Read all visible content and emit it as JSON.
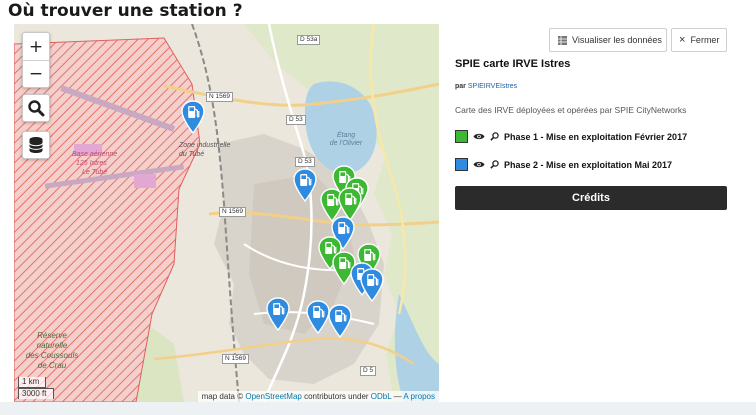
{
  "page": {
    "title": "Où trouver une station ?"
  },
  "map": {
    "controls": {
      "zoom_in": "+",
      "zoom_out": "−",
      "search_icon": "search-icon",
      "layers_icon": "layers-icon"
    },
    "scale": {
      "metric": "1 km",
      "imperial": "3000 ft"
    },
    "attribution": {
      "prefix": "map data ©",
      "osm": "OpenStreetMap",
      "middle": "contributors under",
      "license": "ODbL",
      "sep": "—",
      "about": "A propos"
    },
    "labels": {
      "zone": "Zone industrielle\ndu Tubé",
      "base1": "Base aérienne",
      "base2": "125 Istres",
      "base3": "Le Tubé",
      "reserve": "Réserve\nnaturelle\ndes Coussouls\nde Crau",
      "lake": "Étang\nde l'Olivier"
    },
    "roads": [
      "D 53a",
      "D 53",
      "N 1569",
      "D 53",
      "N 1569",
      "N 1569",
      "D 5"
    ],
    "colors": {
      "phase1": "#3cb832",
      "phase2": "#2f8be0",
      "military": "#e8706a"
    }
  },
  "panel": {
    "viz_label": "Visualiser les données",
    "close_label": "Fermer",
    "title": "SPIE carte IRVE Istres",
    "author_prefix": "par",
    "author": "SPIEIRVEIstres",
    "description": "Carte des IRVE déployées et opérées par SPIE CityNetworks",
    "legend": [
      {
        "label": "Phase 1 - Mise en exploitation Février 2017",
        "color": "#3cb832"
      },
      {
        "label": "Phase 2 - Mise en exploitation Mai 2017",
        "color": "#2f8be0"
      }
    ],
    "credits_label": "Crédits"
  }
}
